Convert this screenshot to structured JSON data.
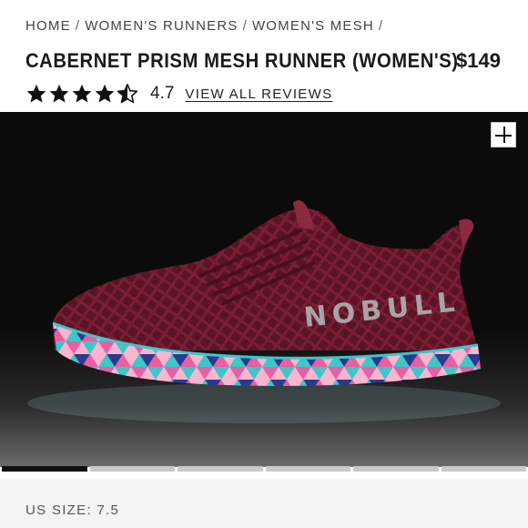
{
  "breadcrumb": {
    "items": [
      "HOME",
      "WOMEN'S RUNNERS",
      "WOMEN'S MESH"
    ],
    "separator": "/"
  },
  "product": {
    "title": "CABERNET PRISM MESH RUNNER (WOMEN'S)",
    "price": "$149",
    "rating": "4.7",
    "rating_stars": 4.5,
    "reviews_link": "VIEW ALL REVIEWS",
    "size_label": "US SIZE: 7.5",
    "shoe_color": "#7a1f33",
    "sole_colors": [
      "#e95fa2",
      "#3ec6c9",
      "#2b3a8f",
      "#f7b6d0"
    ]
  },
  "gallery": {
    "slide_count": 6,
    "active_slide": 1,
    "zoom_icon": "plus-icon"
  }
}
